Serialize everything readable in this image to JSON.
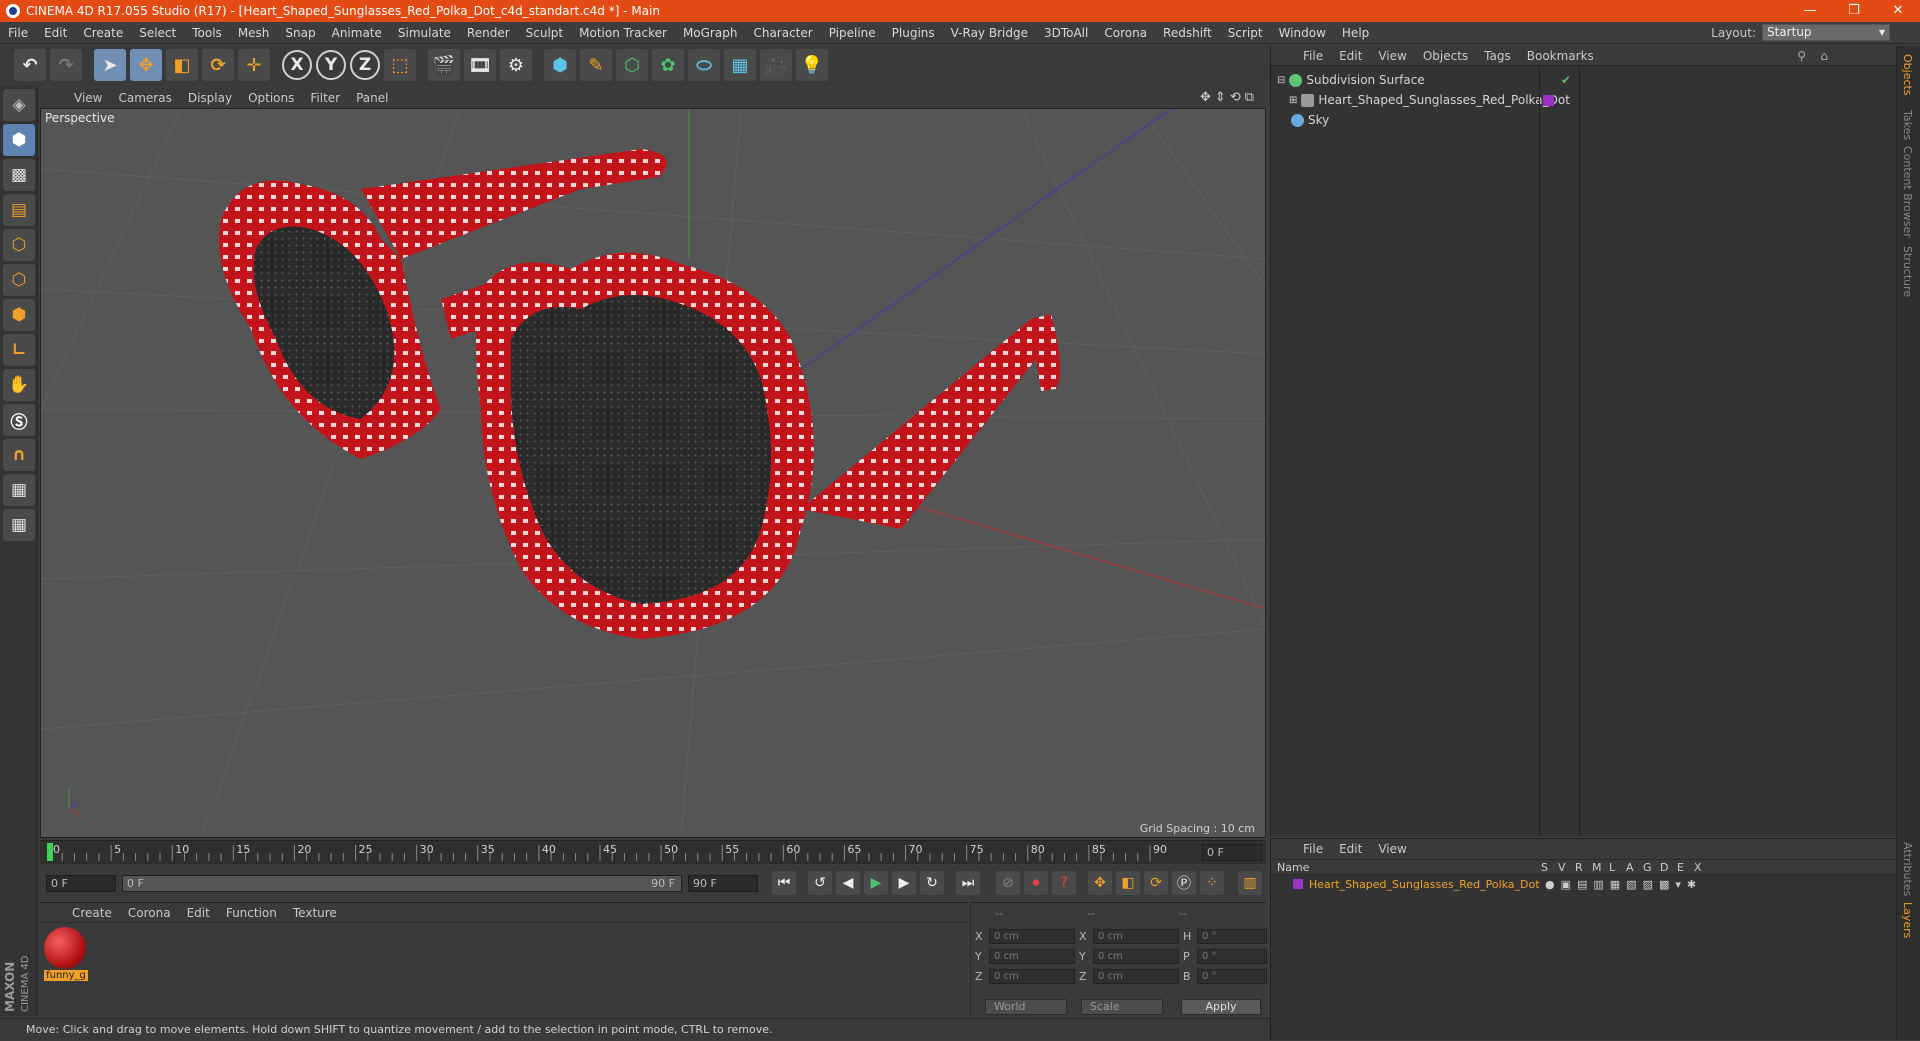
{
  "window": {
    "title": "CINEMA 4D R17.055 Studio (R17) - [Heart_Shaped_Sunglasses_Red_Polka_Dot_c4d_standart.c4d *] - Main",
    "controls": [
      "—",
      "❐",
      "✕"
    ]
  },
  "menubar": [
    "File",
    "Edit",
    "Create",
    "Select",
    "Tools",
    "Mesh",
    "Snap",
    "Animate",
    "Simulate",
    "Render",
    "Sculpt",
    "Motion Tracker",
    "MoGraph",
    "Character",
    "Pipeline",
    "Plugins",
    "V-Ray Bridge",
    "3DToAll",
    "Corona",
    "Redshift",
    "Script",
    "Window",
    "Help"
  ],
  "layout": {
    "label": "Layout:",
    "value": "Startup"
  },
  "toolbar": {
    "axis_x": "X",
    "axis_y": "Y",
    "axis_z": "Z"
  },
  "viewport": {
    "menu": [
      "View",
      "Cameras",
      "Display",
      "Options",
      "Filter",
      "Panel"
    ],
    "label": "Perspective",
    "grid_spacing": "Grid Spacing : 10 cm"
  },
  "timeline": {
    "ticks": [
      "0",
      "5",
      "10",
      "15",
      "20",
      "25",
      "30",
      "35",
      "40",
      "45",
      "50",
      "55",
      "60",
      "65",
      "70",
      "75",
      "80",
      "85",
      "90"
    ],
    "current_frame": "0 F",
    "start_field": "0 F",
    "range_start": "0 F",
    "range_end": "90 F",
    "end_field": "90 F"
  },
  "material_panel": {
    "menu": [
      "Create",
      "Corona",
      "Edit",
      "Function",
      "Texture"
    ],
    "materials": [
      {
        "name": "funny_g"
      }
    ]
  },
  "coordinates": {
    "headers": [
      "--",
      "--",
      "--"
    ],
    "rows": [
      {
        "a1": "X",
        "v1": "0 cm",
        "a2": "X",
        "v2": "0 cm",
        "a3": "H",
        "v3": "0 °"
      },
      {
        "a1": "Y",
        "v1": "0 cm",
        "a2": "Y",
        "v2": "0 cm",
        "a3": "P",
        "v3": "0 °"
      },
      {
        "a1": "Z",
        "v1": "0 cm",
        "a2": "Z",
        "v2": "0 cm",
        "a3": "B",
        "v3": "0 °"
      }
    ],
    "mode": "World",
    "transform": "Scale",
    "apply": "Apply"
  },
  "statusbar": {
    "text": "Move: Click and drag to move elements. Hold down SHIFT to quantize movement / add to the selection in point mode, CTRL to remove."
  },
  "object_manager": {
    "menu": [
      "File",
      "Edit",
      "View",
      "Objects",
      "Tags",
      "Bookmarks"
    ],
    "objects": [
      {
        "name": "Subdivision Surface",
        "icon_color": "#5fc27a"
      },
      {
        "name": "Heart_Shaped_Sunglasses_Red_Polka_Dot",
        "icon_color": "#9a9a9a"
      },
      {
        "name": "Sky",
        "icon_color": "#6aa8e0"
      }
    ]
  },
  "layer_manager": {
    "menu": [
      "File",
      "Edit",
      "View"
    ],
    "columns": [
      "Name",
      "S",
      "V",
      "R",
      "M",
      "L",
      "A",
      "G",
      "D",
      "E",
      "X"
    ],
    "layers": [
      {
        "name": "Heart_Shaped_Sunglasses_Red_Polka_Dot",
        "color": "#9b32c8"
      }
    ]
  },
  "side_tabs": [
    "Objects",
    "Takes",
    "Content Browser",
    "Structure"
  ],
  "side_tabs_bottom": [
    "Attributes",
    "Layers"
  ],
  "brand": {
    "maxon": "MAXON",
    "product": "CINEMA 4D"
  },
  "colors": {
    "accent": "#f0a028",
    "titlebar": "#e44a14",
    "selection_blue": "#6f8fb5"
  }
}
